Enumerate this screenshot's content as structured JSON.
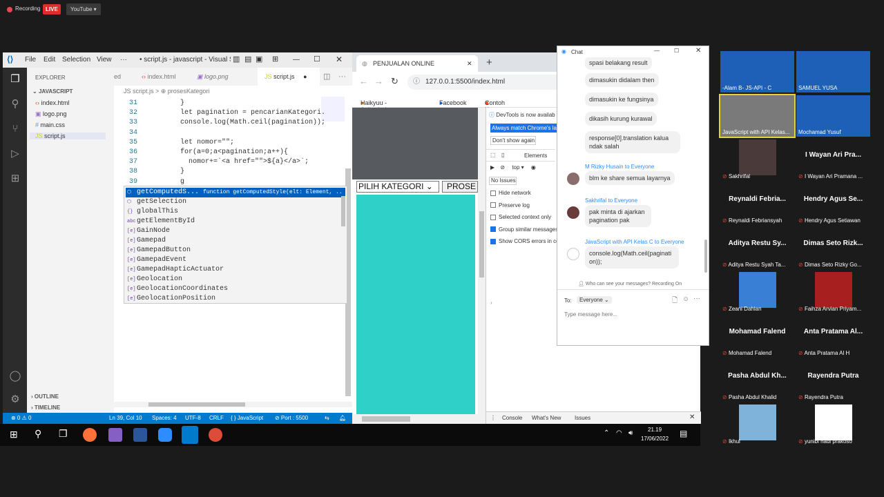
{
  "recording": {
    "label": "Recording",
    "live": "LIVE",
    "platform": "YouTube"
  },
  "vscode": {
    "title": "• script.js - javascript - Visual St...",
    "menu": [
      "File",
      "Edit",
      "Selection",
      "View",
      "···"
    ],
    "explorer_header": "EXPLORER",
    "project": "JAVASCRIPT",
    "files": [
      "index.html",
      "logo.png",
      "main.css",
      "script.js"
    ],
    "outline": "OUTLINE",
    "timeline": "TIMELINE",
    "tabs": [
      "ed",
      "index.html",
      "logo.png",
      "script.js"
    ],
    "breadcrumb": "JS script.js > ⊕ prosesKategori",
    "lines": [
      {
        "n": "31",
        "code": "}"
      },
      {
        "n": "32",
        "code": "let pagination = pencarianKategori."
      },
      {
        "n": "33",
        "code": "console.log(Math.ceil(pagination));"
      },
      {
        "n": "34",
        "code": ""
      },
      {
        "n": "35",
        "code": "let nomor=\"\";"
      },
      {
        "n": "36",
        "code": "for(a=0;a<pagination;a++){"
      },
      {
        "n": "37",
        "code": "  nomor+=`<a href=\"\">${a}</a>`;"
      },
      {
        "n": "38",
        "code": "}"
      },
      {
        "n": "39",
        "code": "g"
      }
    ],
    "suggestions": [
      {
        "label": "getComputedS...",
        "detail": "function getComputedStyle(elt: Element, ...",
        "glyph": "⬡"
      },
      {
        "label": "getSelection",
        "detail": "",
        "glyph": "⬡"
      },
      {
        "label": "globalThis",
        "detail": "",
        "glyph": "{}"
      },
      {
        "label": "getElementById",
        "detail": "",
        "glyph": "abc"
      },
      {
        "label": "GainNode",
        "detail": "",
        "glyph": "[e]"
      },
      {
        "label": "Gamepad",
        "detail": "",
        "glyph": "[e]"
      },
      {
        "label": "GamepadButton",
        "detail": "",
        "glyph": "[e]"
      },
      {
        "label": "GamepadEvent",
        "detail": "",
        "glyph": "[e]"
      },
      {
        "label": "GamepadHapticActuator",
        "detail": "",
        "glyph": "[e]"
      },
      {
        "label": "Geolocation",
        "detail": "",
        "glyph": "[e]"
      },
      {
        "label": "GeolocationCoordinates",
        "detail": "",
        "glyph": "[e]"
      },
      {
        "label": "GeolocationPosition",
        "detail": "",
        "glyph": "[e]"
      }
    ],
    "status": {
      "problems": "⊗ 0 ⚠ 0",
      "position": "Ln 39, Col 10",
      "spaces": "Spaces: 4",
      "encoding": "UTF-8",
      "eol": "CRLF",
      "language": "{ } JavaScript",
      "port": "⊘ Port : 5500"
    }
  },
  "chrome": {
    "tab_title": "PENJUALAN ONLINE",
    "url": "127.0.0.1:5500/index.html",
    "bookmarks": [
      "Haikyuu - Animeindo",
      "Facebook",
      "Contoh Kasus Pelan..."
    ],
    "select_label": "PILIH KATEGORI",
    "button_label": "PROSE",
    "devtools": {
      "banner": "DevTools is now availab",
      "always_match": "Always match Chrome's la",
      "dont_show": "Don't show again",
      "elements_tab": "Elements",
      "context": "top",
      "issues": "No Issues",
      "options": [
        "Hide network",
        "Preserve log",
        "Selected context only",
        "Group similar messages",
        "Show CORS errors in co"
      ],
      "drawer_tabs": [
        "Console",
        "What's New",
        "Issues"
      ]
    }
  },
  "chat": {
    "title": "Chat",
    "messages_top": [
      "spasi belakang result",
      "dimasukin didalam then",
      "dimasukin ke fungsinya",
      "dikasih kurung kurawal",
      "response[0].translation kalua ndak salah"
    ],
    "groups": [
      {
        "sender": "M Rizky Husain to Everyone",
        "text": "blm ke share semua layarnya"
      },
      {
        "sender": "Sakhrifal to Everyone",
        "text": "pak minta di ajarkan pagination pak"
      },
      {
        "sender": "JavaScript with API Kelas C to Everyone",
        "text": "console.log(Math.ceil(pagination));"
      }
    ],
    "privacy": "Who can see your messages? Recording On",
    "to_label": "To:",
    "to_value": "Everyone",
    "input_placeholder": "Type message here..."
  },
  "participants": [
    {
      "name": "",
      "label": "-Alam B- JS-API - C"
    },
    {
      "name": "",
      "label": "SAMUEL YUSA"
    },
    {
      "name": "",
      "label": "JavaScript with API Kelas..."
    },
    {
      "name": "",
      "label": "Mochamad Yusuf"
    },
    {
      "name": "",
      "label": "Sakhrifal"
    },
    {
      "name": "I Wayan Ari Pra...",
      "label": "I Wayan Ari Pramana ..."
    },
    {
      "name": "Reynaldi Febria...",
      "label": "Reynaldi Febriansyah"
    },
    {
      "name": "Hendry Agus Se...",
      "label": "Hendry Agus Setiawan"
    },
    {
      "name": "Aditya Restu Sy...",
      "label": "Aditya Restu Syah Ta..."
    },
    {
      "name": "Dimas Seto Rizk...",
      "label": "Dimas Seto Rizky Go..."
    },
    {
      "name": "",
      "label": "Zeani Dahlan"
    },
    {
      "name": "",
      "label": "Faihza Arvian Priyam..."
    },
    {
      "name": "Mohamad Falend",
      "label": "Mohamad Falend"
    },
    {
      "name": "Anta Pratama Al...",
      "label": "Anta Pratama Al H"
    },
    {
      "name": "Pasha Abdul Kh...",
      "label": "Pasha Abdul Khalid"
    },
    {
      "name": "Rayendra Putra",
      "label": "Rayendra Putra"
    },
    {
      "name": "",
      "label": "Ikhul"
    },
    {
      "name": "",
      "label": "yunibi hadi prakoso"
    }
  ],
  "taskbar": {
    "time": "21.19",
    "date": "17/06/2022"
  }
}
